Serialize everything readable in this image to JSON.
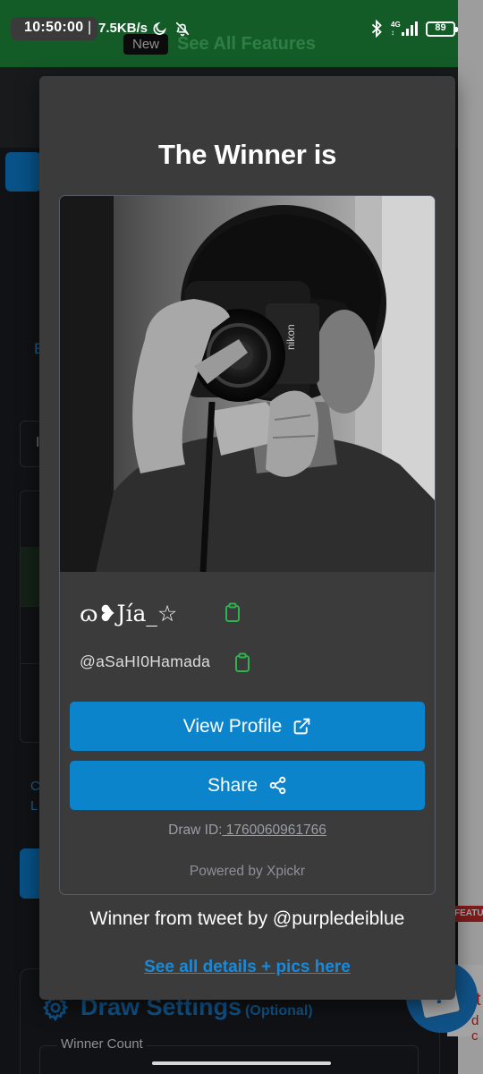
{
  "status_bar": {
    "time": "10:50:00",
    "separator": "|",
    "net_speed": "7.5KB/s",
    "network_type": "4G",
    "battery": "89",
    "icons": [
      "moon-icon",
      "bell-off-icon",
      "bluetooth-icon",
      "signal-icon",
      "battery-icon"
    ]
  },
  "background": {
    "banner_badge": "New",
    "banner_text": "See All Features",
    "link_fragment": "E",
    "field_fragment": "I",
    "link_fragment_2": "C\nL",
    "settings_title": "Draw Settings",
    "settings_optional": "(Optional)",
    "winner_count_label": "Winner Count",
    "feature_badge": "FEATUR",
    "help_text": "t",
    "help_text_2": "d c"
  },
  "modal": {
    "title": "The Winner is",
    "winner": {
      "display_name": "ɷ❥Jía_☆",
      "handle": "@aSaHI0Hamada"
    },
    "buttons": {
      "view_profile": "View Profile",
      "share": "Share"
    },
    "draw_id_label": "Draw ID:",
    "draw_id": " 1760060961766",
    "powered_by": "Powered by Xpickr",
    "from_tweet": "Winner from tweet by @purpledeiblue",
    "details_link": "See all details + pics here"
  },
  "colors": {
    "modal_bg": "#3b3b3b",
    "button_blue": "#0b84cc",
    "link_blue": "#1a8ad8",
    "copy_green": "#2fb34f"
  }
}
